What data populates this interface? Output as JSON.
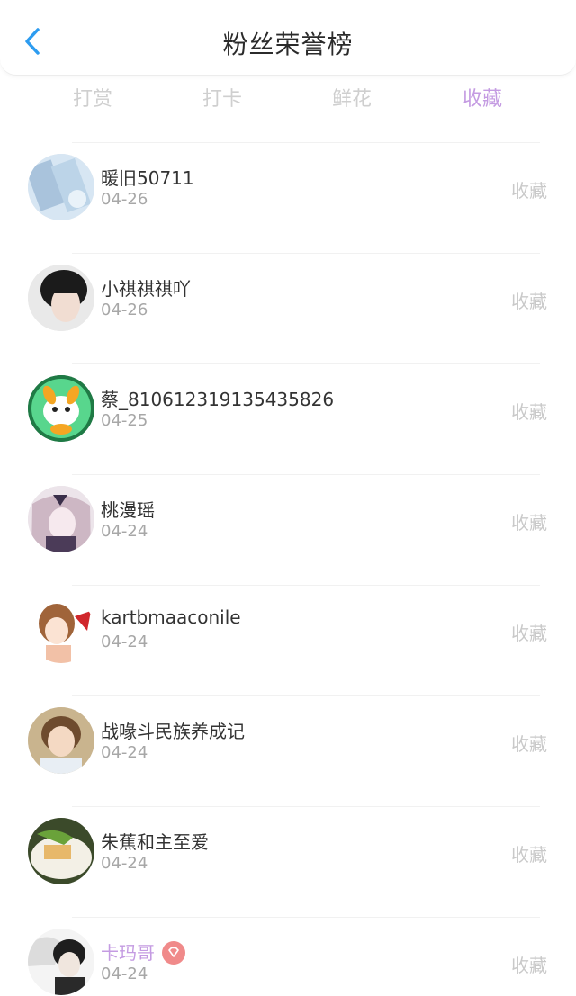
{
  "header": {
    "title": "粉丝荣誉榜"
  },
  "tabs": [
    {
      "label": "打赏",
      "active": false
    },
    {
      "label": "打卡",
      "active": false
    },
    {
      "label": "鲜花",
      "active": false
    },
    {
      "label": "收藏",
      "active": true
    }
  ],
  "colors": {
    "accent": "#c49be2",
    "back_icon": "#2d9cf0",
    "vip_badge": "#f08a8a"
  },
  "fans": [
    {
      "name": "暖旧50711",
      "date": "04-26",
      "tag": "收藏",
      "vip": false
    },
    {
      "name": "小祺祺祺吖",
      "date": "04-26",
      "tag": "收藏",
      "vip": false
    },
    {
      "name": "蔡_810612319135435826",
      "date": "04-25",
      "tag": "收藏",
      "vip": false
    },
    {
      "name": "桃漫瑶",
      "date": "04-24",
      "tag": "收藏",
      "vip": false
    },
    {
      "name": "kartbmaaconile",
      "date": "04-24",
      "tag": "收藏",
      "vip": false
    },
    {
      "name": "战喙斗民族养成记",
      "date": "04-24",
      "tag": "收藏",
      "vip": false
    },
    {
      "name": "朱蕉和主至爱",
      "date": "04-24",
      "tag": "收藏",
      "vip": false
    },
    {
      "name": "卡玛哥",
      "date": "04-24",
      "tag": "收藏",
      "vip": true
    }
  ]
}
